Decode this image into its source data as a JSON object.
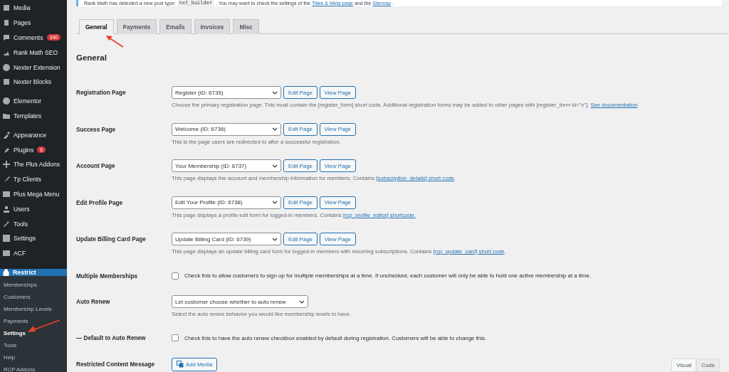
{
  "sidebar": {
    "menu_groups": [
      [
        {
          "label": "Media"
        },
        {
          "label": "Pages"
        },
        {
          "label": "Comments",
          "badge": "340"
        },
        {
          "label": "Rank Math SEO"
        },
        {
          "label": "Nexter Extension"
        },
        {
          "label": "Nexter Blocks"
        }
      ],
      [
        {
          "label": "Elementor"
        },
        {
          "label": "Templates"
        }
      ],
      [
        {
          "label": "Appearance"
        },
        {
          "label": "Plugins",
          "badge": "6"
        },
        {
          "label": "The Plus Addons"
        },
        {
          "label": "Tp Clients"
        },
        {
          "label": "Plus Mega Menu"
        },
        {
          "label": "Users"
        },
        {
          "label": "Tools"
        },
        {
          "label": "Settings"
        },
        {
          "label": "ACF"
        }
      ]
    ],
    "current": {
      "label": "Restrict"
    },
    "submenu": [
      {
        "label": "Memberships",
        "selected": false
      },
      {
        "label": "Customers",
        "selected": false
      },
      {
        "label": "Membership Levels",
        "selected": false
      },
      {
        "label": "Payments",
        "selected": false
      },
      {
        "label": "Settings",
        "selected": true
      },
      {
        "label": "Tools",
        "selected": false
      },
      {
        "label": "Help",
        "selected": false
      },
      {
        "label": "RCP Addons",
        "selected": false
      }
    ]
  },
  "notice": {
    "before": "Rank Math has detected a new post type:",
    "code": "nxt_builder",
    "middle": ". You may want to check the settings of the",
    "link1": "Titles & Meta page",
    "and": "and the",
    "link2": "Sitemap",
    "after": "."
  },
  "tabs": [
    {
      "label": "General",
      "selected": true
    },
    {
      "label": "Payments",
      "selected": false
    },
    {
      "label": "Emails",
      "selected": false
    },
    {
      "label": "Invoices",
      "selected": false
    },
    {
      "label": "Misc",
      "selected": false
    }
  ],
  "heading": "General",
  "rows": [
    {
      "kind": "page_select",
      "label": "Registration Page",
      "value": "Register (ID: 6735)",
      "buttons": [
        "Edit Page",
        "View Page"
      ],
      "description": {
        "text": "Choose the primary registration page. This must contain the [register_form] short code. Additional registration forms may be added to other pages with [register_form id=\"x\"].",
        "link": "See documentation",
        "after": "."
      }
    },
    {
      "kind": "page_select",
      "label": "Success Page",
      "value": "Welcome (ID: 6736)",
      "buttons": [
        "Edit Page",
        "View Page"
      ],
      "description": {
        "text": "This is the page users are redirected to after a successful registration."
      }
    },
    {
      "kind": "page_select",
      "label": "Account Page",
      "value": "Your Membership (ID: 6737)",
      "buttons": [
        "Edit Page",
        "View Page"
      ],
      "description": {
        "text": "This page displays the account and membership information for members. Contains",
        "link": "[subscription_details] short code",
        "after": "."
      }
    },
    {
      "kind": "page_select",
      "label": "Edit Profile Page",
      "value": "Edit Your Profile (ID: 6738)",
      "buttons": [
        "Edit Page",
        "View Page"
      ],
      "description": {
        "text": "This page displays a profile edit form for logged-in members. Contains",
        "link": "[rcp_profile_editor] shortcode."
      }
    },
    {
      "kind": "page_select",
      "label": "Update Billing Card Page",
      "value": "Update Billing Card (ID: 6739)",
      "buttons": [
        "Edit Page",
        "View Page"
      ],
      "description": {
        "text": "This page displays an update billing card form for logged-in members with recurring subscriptions. Contains",
        "link": "[rcp_update_card] short code",
        "after": "."
      }
    },
    {
      "kind": "checkbox",
      "label": "Multiple Memberships",
      "checked": false,
      "text": "Check this to allow customers to sign up for multiple memberships at a time. If unchecked, each customer will only be able to hold one active membership at a time."
    },
    {
      "kind": "select",
      "label": "Auto Renew",
      "value": "Let customer choose whether to auto renew",
      "description": {
        "text": "Select the auto renew behavior you would like membership levels to have."
      }
    },
    {
      "kind": "checkbox",
      "label": "— Default to Auto Renew",
      "checked": false,
      "text": "Check this to have the auto renew checkbox enabled by default during registration. Customers will be able to change this."
    },
    {
      "kind": "media",
      "label": "Restricted Content Message",
      "button": "Add Media",
      "editor_tabs": [
        {
          "label": "Visual",
          "selected": true
        },
        {
          "label": "Code",
          "selected": false
        }
      ]
    }
  ]
}
